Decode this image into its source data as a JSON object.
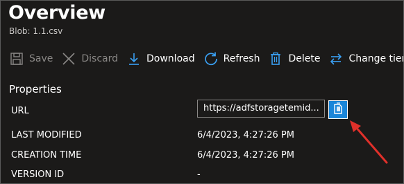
{
  "header": {
    "title": "Overview",
    "subtitle": "Blob: 1.1.csv"
  },
  "toolbar": {
    "save": "Save",
    "discard": "Discard",
    "download": "Download",
    "refresh": "Refresh",
    "delete": "Delete",
    "change_tier": "Change tier"
  },
  "properties": {
    "section_title": "Properties",
    "url_label": "URL",
    "url_value": "https://adfstoragetemid...",
    "last_modified_label": "LAST MODIFIED",
    "last_modified_value": "6/4/2023, 4:27:26 PM",
    "creation_time_label": "CREATION TIME",
    "creation_time_value": "6/4/2023, 4:27:26 PM",
    "version_id_label": "VERSION ID",
    "version_id_value": "-"
  },
  "colors": {
    "background": "#1b1a19",
    "accent_blue": "#1a86d9",
    "arrow_red": "#e0302a",
    "disabled_text": "#8a8886"
  },
  "icons": [
    "save-icon",
    "discard-icon",
    "download-icon",
    "refresh-icon",
    "delete-icon",
    "change-tier-icon",
    "copy-icon"
  ]
}
